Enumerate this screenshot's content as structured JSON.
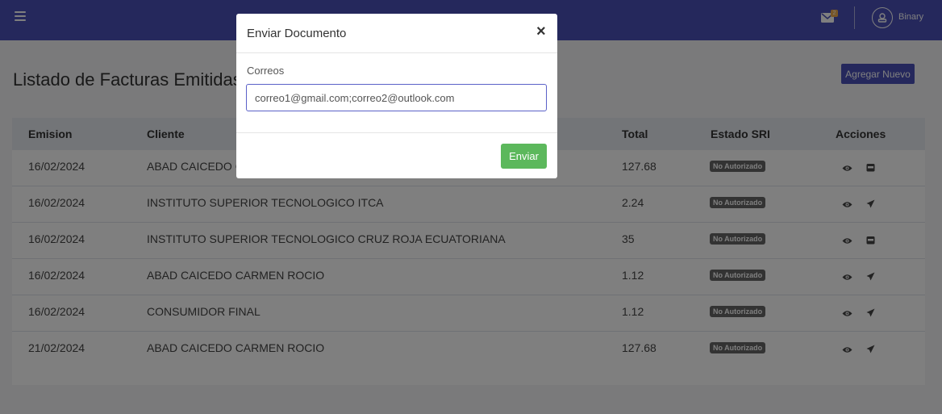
{
  "topbar": {
    "menu_icon": "hamburger-icon",
    "mail_icon": "envelope-icon",
    "mail_badge": "2",
    "user_icon": "user-avatar-icon",
    "username": "Binary",
    "color": "#4a50b8"
  },
  "page": {
    "title": "Listado de Facturas Emitidas",
    "add_button": "Agregar Nuevo"
  },
  "table": {
    "headers": {
      "emision": "Emision",
      "cliente": "Cliente",
      "total": "Total",
      "estado": "Estado SRI",
      "acciones": "Acciones"
    },
    "rows": [
      {
        "emision": "16/02/2024",
        "cliente": "ABAD CAICEDO CA",
        "total": "127.68",
        "estado": "No Autorizado",
        "action2": "archive-icon"
      },
      {
        "emision": "16/02/2024",
        "cliente": "INSTITUTO SUPERIOR TECNOLOGICO ITCA",
        "total": "2.24",
        "estado": "No Autorizado",
        "action2": "send-icon"
      },
      {
        "emision": "16/02/2024",
        "cliente": "INSTITUTO SUPERIOR TECNOLOGICO CRUZ ROJA ECUATORIANA",
        "total": "35",
        "estado": "No Autorizado",
        "action2": "archive-icon"
      },
      {
        "emision": "16/02/2024",
        "cliente": "ABAD CAICEDO CARMEN ROCIO",
        "total": "1.12",
        "estado": "No Autorizado",
        "action2": "send-icon"
      },
      {
        "emision": "16/02/2024",
        "cliente": "CONSUMIDOR FINAL",
        "total": "1.12",
        "estado": "No Autorizado",
        "action2": "send-icon"
      },
      {
        "emision": "21/02/2024",
        "cliente": "ABAD CAICEDO CARMEN ROCIO",
        "total": "127.68",
        "estado": "No Autorizado",
        "action2": "send-icon"
      }
    ]
  },
  "modal": {
    "title": "Enviar Documento",
    "close": "×",
    "field_label": "Correos",
    "field_value": "correo1@gmail.com;correo2@outlook.com",
    "submit": "Enviar"
  },
  "colors": {
    "primary": "#4a50b8",
    "success": "#5cb85c",
    "badge": "#666666",
    "overlay": "rgba(0,0,0,0.5)"
  }
}
